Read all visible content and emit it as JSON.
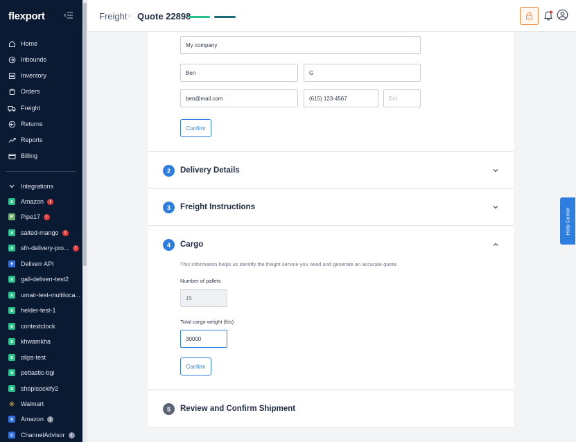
{
  "sidebar": {
    "brand": "flexport",
    "nav": [
      {
        "label": "Home",
        "icon": "home-icon"
      },
      {
        "label": "Inbounds",
        "icon": "inbound-icon"
      },
      {
        "label": "Inventory",
        "icon": "inventory-icon"
      },
      {
        "label": "Orders",
        "icon": "orders-icon"
      },
      {
        "label": "Freight",
        "icon": "freight-icon"
      },
      {
        "label": "Returns",
        "icon": "returns-icon"
      },
      {
        "label": "Reports",
        "icon": "reports-icon"
      },
      {
        "label": "Billing",
        "icon": "billing-icon"
      }
    ],
    "integrations_label": "Integrations",
    "integrations": [
      {
        "label": "Amazon",
        "badge": "!"
      },
      {
        "label": "Pipe17",
        "badge": "!"
      },
      {
        "label": "salted-mango",
        "badge": "!"
      },
      {
        "label": "sfn-delivery-pro...",
        "badge": "!"
      },
      {
        "label": "Deliverr API"
      },
      {
        "label": "gall-deliverr-test2"
      },
      {
        "label": "umair-test-multiloca..."
      },
      {
        "label": "helder-test-1"
      },
      {
        "label": "contextclock"
      },
      {
        "label": "khwamkha"
      },
      {
        "label": "olips-test"
      },
      {
        "label": "pettastic-bgi"
      },
      {
        "label": "shopisockify2"
      },
      {
        "label": "Walmart"
      },
      {
        "label": "Amazon",
        "badge": "i"
      },
      {
        "label": "ChannelAdvisor",
        "badge": "i"
      }
    ]
  },
  "header": {
    "crumb_root": "Freight",
    "crumb_sep": "›",
    "crumb_current": "Quote 22898"
  },
  "contact": {
    "company": "My company",
    "first_name": "Ben",
    "last_name": "G",
    "email": "ben@mail.com",
    "phone": "(615) 123-4567",
    "ext_placeholder": "Ext",
    "confirm_label": "Confirm"
  },
  "sections": {
    "delivery": {
      "num": "2",
      "title": "Delivery Details"
    },
    "instructions": {
      "num": "3",
      "title": "Freight Instructions"
    },
    "cargo": {
      "num": "4",
      "title": "Cargo",
      "help": "This information helps us identify the freight service you need and generate an accurate quote.",
      "pallets_label": "Number of pallets",
      "pallets_value": "15",
      "weight_label": "Total cargo weight (lbs)",
      "weight_value": "30000",
      "confirm_label": "Confirm"
    },
    "review": {
      "num": "5",
      "title": "Review and Confirm Shipment"
    }
  },
  "help_center": "Help Center",
  "colors": {
    "sidebar_bg": "#0b1a33",
    "accent_blue": "#2e7ee0",
    "accent_green": "#27c28a",
    "alert_red": "#e23a3a",
    "lock_orange": "#f08a3c"
  }
}
